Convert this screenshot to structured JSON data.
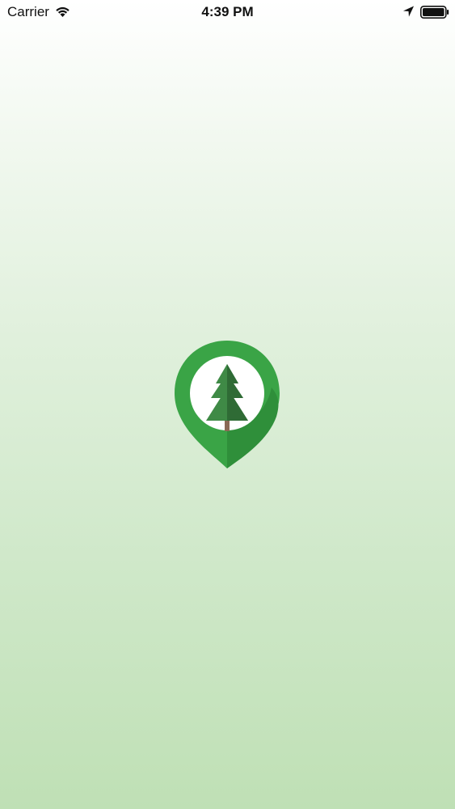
{
  "status_bar": {
    "carrier": "Carrier",
    "time": "4:39 PM",
    "icons": [
      "wifi-icon",
      "location-arrow-icon",
      "battery-icon"
    ]
  },
  "splash": {
    "logo": "pine-tree-location-pin-logo"
  },
  "colors": {
    "pin_green": "#3aa446",
    "pin_shadow_green": "#2f8f3a",
    "tree_dark": "#2f6b35",
    "tree_light": "#3f8a46",
    "trunk": "#8a6a55",
    "background_top": "#ffffff",
    "background_bottom": "#bfe0b5"
  }
}
